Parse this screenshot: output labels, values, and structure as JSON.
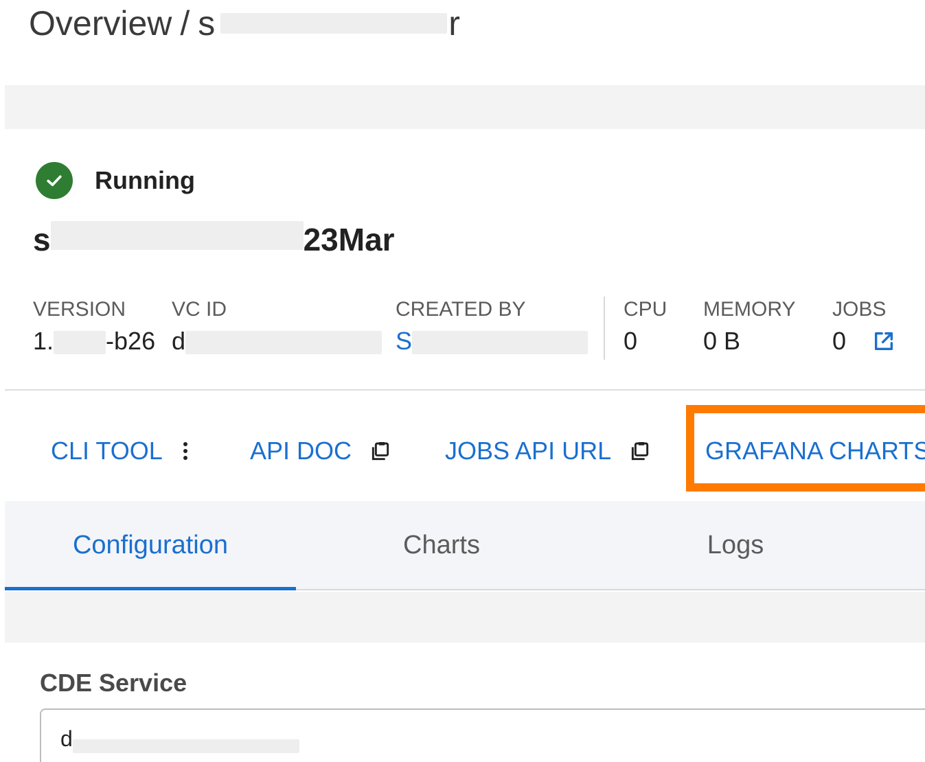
{
  "breadcrumb": {
    "root": "Overview",
    "separator": "/",
    "current_prefix": "s",
    "current_suffix": "r"
  },
  "status": {
    "label": "Running",
    "icon": "check-circle-icon",
    "color": "#2e7d32"
  },
  "service": {
    "name_prefix": "s",
    "name_suffix": "23Mar"
  },
  "metadata": {
    "version": {
      "label": "VERSION",
      "value_prefix": "1.",
      "value_suffix": "-b26"
    },
    "vc_id": {
      "label": "VC ID",
      "value_prefix": "d"
    },
    "created_by": {
      "label": "CREATED BY",
      "value_prefix": "S"
    },
    "cpu": {
      "label": "CPU",
      "value": "0"
    },
    "memory": {
      "label": "MEMORY",
      "value": "0 B"
    },
    "jobs": {
      "label": "JOBS",
      "value": "0",
      "link_icon": "external-link-icon"
    }
  },
  "actions": {
    "cli_tool": {
      "label": "CLI TOOL",
      "icon": "more-vertical-icon"
    },
    "api_doc": {
      "label": "API DOC",
      "icon": "copy-icon"
    },
    "jobs_api_url": {
      "label": "JOBS API URL",
      "icon": "copy-icon"
    },
    "grafana_charts": {
      "label": "GRAFANA CHARTS",
      "highlight_color": "#ff7a00"
    }
  },
  "tabs": [
    {
      "label": "Configuration",
      "active": true
    },
    {
      "label": "Charts",
      "active": false
    },
    {
      "label": "Logs",
      "active": false
    }
  ],
  "config": {
    "cde_service": {
      "label": "CDE Service",
      "value_prefix": "d"
    }
  },
  "colors": {
    "accent": "#1a6fd0",
    "highlight": "#ff7a00",
    "success": "#2e7d32"
  }
}
